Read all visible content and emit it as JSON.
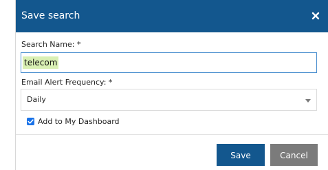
{
  "dialog": {
    "title": "Save search",
    "close_icon": "close-icon"
  },
  "form": {
    "search_name_label": "Search Name: *",
    "search_name_value": "telecom",
    "frequency_label": "Email Alert Frequency: *",
    "frequency_selected": "Daily",
    "dashboard_checkbox_label": "Add to My Dashboard",
    "dashboard_checked": true
  },
  "footer": {
    "save_label": "Save",
    "cancel_label": "Cancel"
  },
  "colors": {
    "header_bg": "#13578e",
    "save_bg": "#13578e",
    "cancel_bg": "#7b7b7b",
    "input_highlight": "#d9f0b4",
    "input_focus_border": "#4a8fcf",
    "checkbox": "#1a73e8"
  }
}
